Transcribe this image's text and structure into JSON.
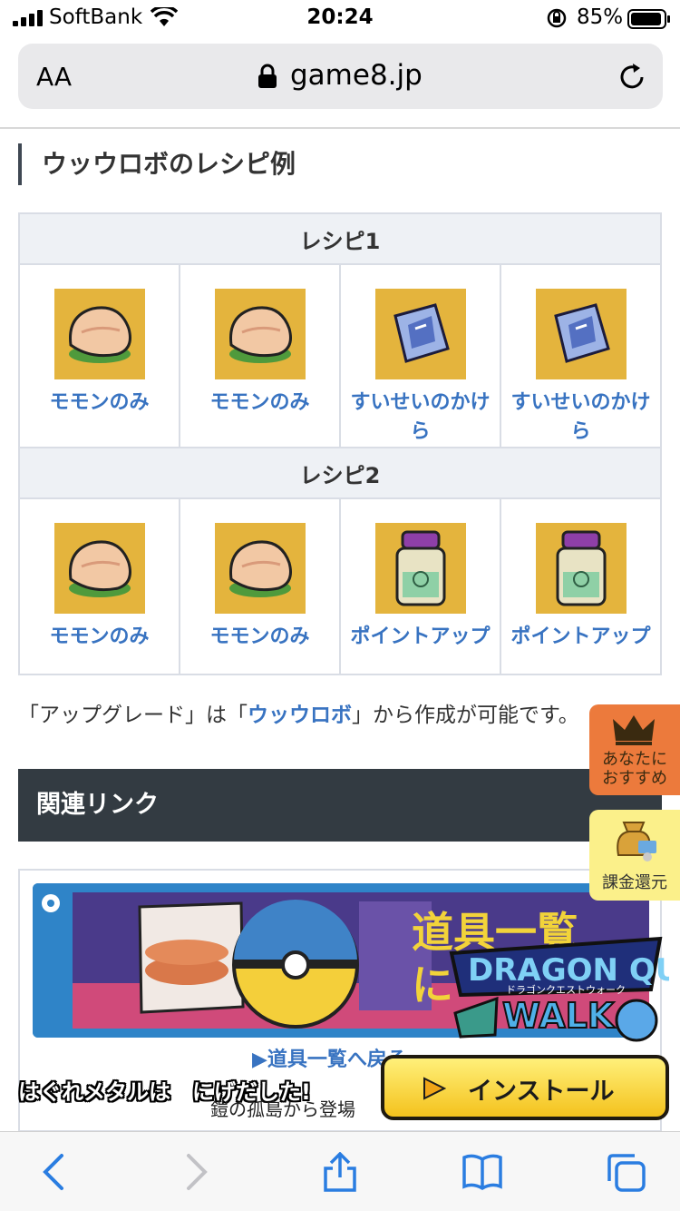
{
  "status_bar": {
    "carrier": "SoftBank",
    "time": "20:24",
    "battery": "85%"
  },
  "url_bar": {
    "text_size_label": "AA",
    "domain": "game8.jp"
  },
  "heading": "ウッウロボのレシピ例",
  "recipes": [
    {
      "title": "レシピ1",
      "items": [
        {
          "name": "モモンのみ",
          "icon": "momon-berry-icon"
        },
        {
          "name": "モモンのみ",
          "icon": "momon-berry-icon"
        },
        {
          "name": "すいせいのかけら",
          "icon": "comet-shard-icon"
        },
        {
          "name": "すいせいのかけら",
          "icon": "comet-shard-icon"
        }
      ]
    },
    {
      "title": "レシピ2",
      "items": [
        {
          "name": "モモンのみ",
          "icon": "momon-berry-icon"
        },
        {
          "name": "モモンのみ",
          "icon": "momon-berry-icon"
        },
        {
          "name": "ポイントアップ",
          "icon": "pp-up-icon"
        },
        {
          "name": "ポイントアップ",
          "icon": "pp-up-icon"
        }
      ]
    }
  ],
  "paragraph": {
    "prefix": "「アップグレード」は「",
    "link": "ウッウロボ",
    "suffix": "」から作成が可能です。"
  },
  "section_title": "関連リンク",
  "side_buttons": {
    "recommend": [
      "あなたに",
      "おすすめ"
    ],
    "refund": "課金還元"
  },
  "related": {
    "banner_text": [
      "道具一覧",
      "に"
    ],
    "link_text": "▶道具一覧へ戻る"
  },
  "ad": {
    "caption": "はぐれメタルは　にげだした!",
    "subtext": "鎧の孤島から登場",
    "install_label": "インストール",
    "logo_text": [
      "DRAGON QUEST",
      "ドラゴンクエストウォーク",
      "WALK"
    ]
  },
  "colors": {
    "link_blue": "#3873c1",
    "section_dark": "#333b42",
    "thumb_gold": "#e4b43d",
    "recommend_orange": "#ec7a3c",
    "refund_yellow": "#fbf08a"
  }
}
